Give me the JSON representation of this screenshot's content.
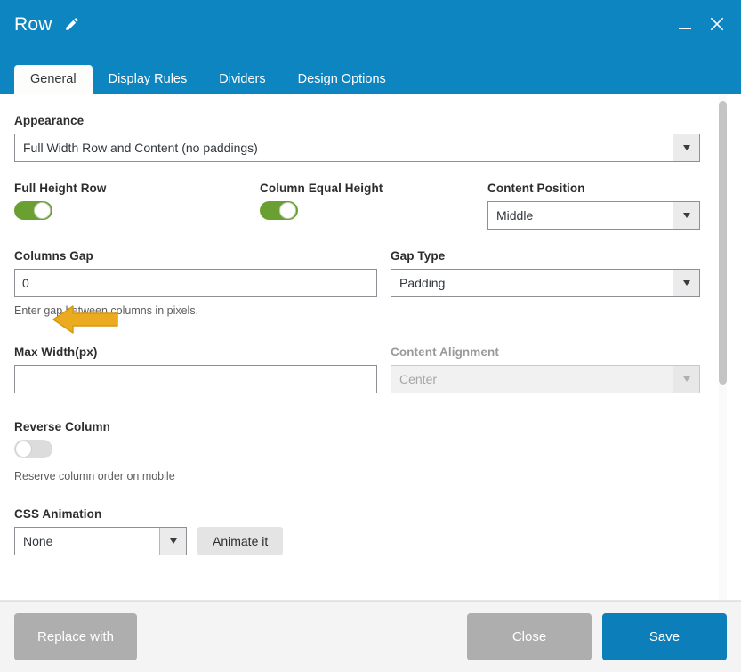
{
  "header": {
    "title": "Row",
    "edit_icon": "pencil-icon",
    "minimize_label": "_",
    "close_label": "✕"
  },
  "tabs": [
    {
      "label": "General",
      "active": true
    },
    {
      "label": "Display Rules",
      "active": false
    },
    {
      "label": "Dividers",
      "active": false
    },
    {
      "label": "Design Options",
      "active": false
    }
  ],
  "fields": {
    "appearance": {
      "label": "Appearance",
      "value": "Full Width Row and Content (no paddings)"
    },
    "full_height_row": {
      "label": "Full Height Row",
      "state": "on"
    },
    "column_equal_height": {
      "label": "Column Equal Height",
      "state": "on"
    },
    "content_position": {
      "label": "Content Position",
      "value": "Middle"
    },
    "columns_gap": {
      "label": "Columns Gap",
      "value": "0",
      "placeholder": "",
      "help": "Enter gap between columns in pixels."
    },
    "gap_type": {
      "label": "Gap Type",
      "value": "Padding"
    },
    "max_width": {
      "label": "Max Width(px)",
      "value": "",
      "placeholder": ""
    },
    "content_alignment": {
      "label": "Content Alignment",
      "value": "Center",
      "disabled": true
    },
    "reverse_column": {
      "label": "Reverse Column",
      "state": "off",
      "help": "Reserve column order on mobile"
    },
    "css_animation": {
      "label": "CSS Animation",
      "value": "None",
      "button_label": "Animate it"
    }
  },
  "annotation": {
    "arrow": "left-pointing-arrow",
    "color": "#ecab1e"
  },
  "footer": {
    "replace_with": "Replace with",
    "close": "Close",
    "save": "Save"
  },
  "colors": {
    "header_blue": "#0c85c1",
    "save_blue": "#0c7fba",
    "toggle_on_green": "#6aa032",
    "annotation_yellow": "#ecab1e",
    "grey_button": "#aeaeae"
  }
}
